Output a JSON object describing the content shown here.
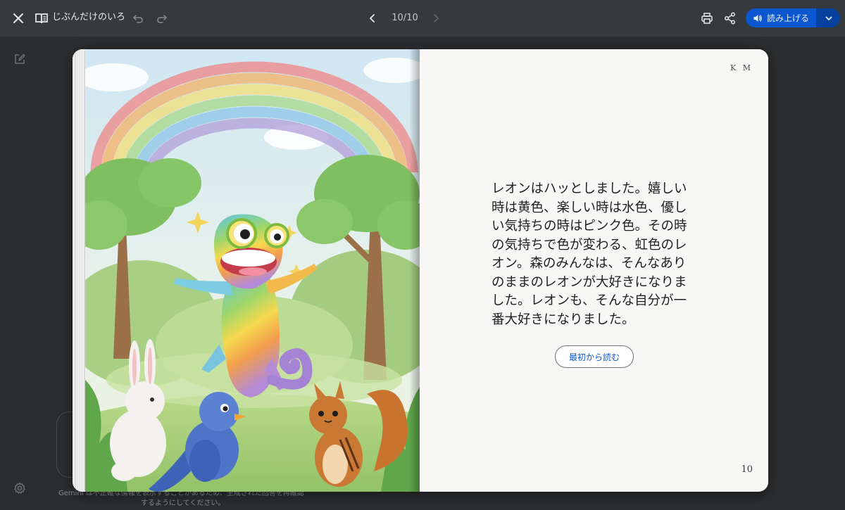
{
  "header": {
    "title": "じぶんだけのいろ",
    "page_indicator": "10/10",
    "read_aloud_label": "読み上げる"
  },
  "book": {
    "author_initials": "K M",
    "story_text": "レオンはハッとしました。嬉しい時は黄色、楽しい時は水色、優しい気持ちの時はピンク色。その時の気持ちで色が変わる、虹色のレオン。森のみんなは、そんなありのままのレオンが大好きになりました。レオンも、そんな自分が一番大好きになりました。",
    "restart_label": "最初から読む",
    "page_number": "10"
  },
  "background": {
    "disclaimer_line1": "Gemini は不正確な情報を表示することがあるため、生成された回答を再確認",
    "disclaimer_line2": "するようにしてください。"
  },
  "icons": {
    "close": "close-icon",
    "book": "book-icon",
    "undo": "undo-icon",
    "redo": "redo-icon",
    "prev": "chevron-left-icon",
    "next": "chevron-right-icon",
    "print": "print-icon",
    "share": "share-icon",
    "volume": "volume-icon",
    "dropdown": "chevron-down-icon",
    "edit": "edit-icon",
    "settings": "gear-icon"
  },
  "colors": {
    "accent": "#0b57d0",
    "topbar": "#363a3d",
    "background": "#2b2d2f"
  }
}
